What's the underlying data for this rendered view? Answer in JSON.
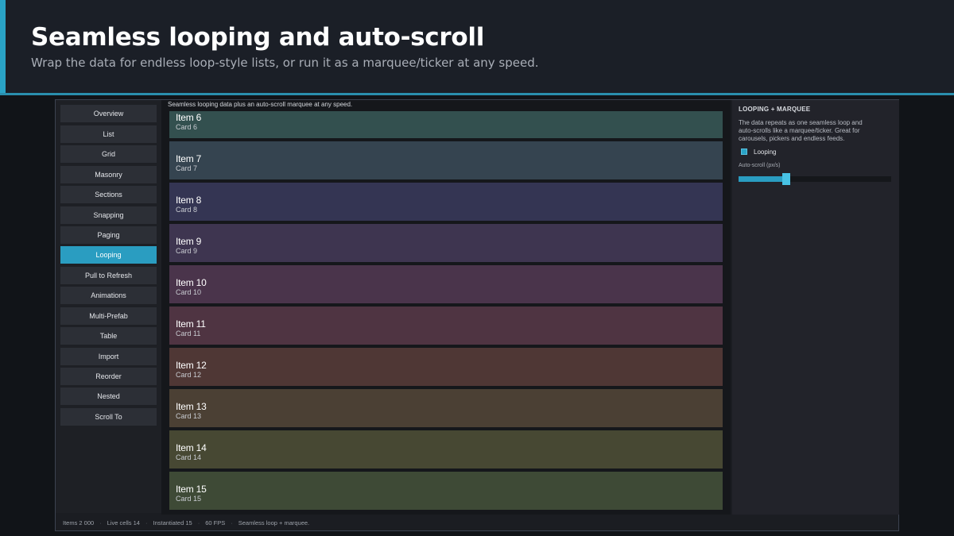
{
  "header": {
    "title": "Seamless looping and auto-scroll",
    "subtitle": "Wrap the data for endless loop-style lists, or run it as a marquee/ticker at any speed."
  },
  "sidebar": {
    "items": [
      {
        "label": "Overview"
      },
      {
        "label": "List"
      },
      {
        "label": "Grid"
      },
      {
        "label": "Masonry"
      },
      {
        "label": "Sections"
      },
      {
        "label": "Snapping"
      },
      {
        "label": "Paging"
      },
      {
        "label": "Looping",
        "active": true
      },
      {
        "label": "Pull to Refresh"
      },
      {
        "label": "Animations"
      },
      {
        "label": "Multi-Prefab"
      },
      {
        "label": "Table"
      },
      {
        "label": "Import"
      },
      {
        "label": "Reorder"
      },
      {
        "label": "Nested"
      },
      {
        "label": "Scroll To"
      }
    ]
  },
  "main": {
    "caption": "Seamless looping data plus an auto-scroll marquee at any speed.",
    "cards": [
      {
        "title": "Item 6",
        "subtitle": "Card 6",
        "color": "#33504f"
      },
      {
        "title": "Item 7",
        "subtitle": "Card 7",
        "color": "#354450"
      },
      {
        "title": "Item 8",
        "subtitle": "Card 8",
        "color": "#343553"
      },
      {
        "title": "Item 9",
        "subtitle": "Card 9",
        "color": "#3e3550"
      },
      {
        "title": "Item 10",
        "subtitle": "Card 10",
        "color": "#4a344b"
      },
      {
        "title": "Item 11",
        "subtitle": "Card 11",
        "color": "#4f3442"
      },
      {
        "title": "Item 12",
        "subtitle": "Card 12",
        "color": "#4f3735"
      },
      {
        "title": "Item 13",
        "subtitle": "Card 13",
        "color": "#4b4034"
      },
      {
        "title": "Item 14",
        "subtitle": "Card 14",
        "color": "#474833"
      },
      {
        "title": "Item 15",
        "subtitle": "Card 15",
        "color": "#3e4a36"
      }
    ]
  },
  "panel": {
    "title": "LOOPING + MARQUEE",
    "description": "The data repeats as one seamless loop and auto-scrolls like a marquee/ticker. Great for carousels, pickers and endless feeds.",
    "looping_label": "Looping",
    "looping_checked": true,
    "slider_label": "Auto-scroll (px/s)",
    "slider_fraction": 0.31
  },
  "status": {
    "items": "Items 2 000",
    "live_cells": "Live cells 14",
    "instantiated": "Instantiated 15",
    "fps": "60 FPS",
    "mode": "Seamless loop + marquee."
  },
  "colors": {
    "accent": "#2aa3c6",
    "active_nav": "#2a9dc1",
    "slider_handle": "#48c2e4"
  }
}
